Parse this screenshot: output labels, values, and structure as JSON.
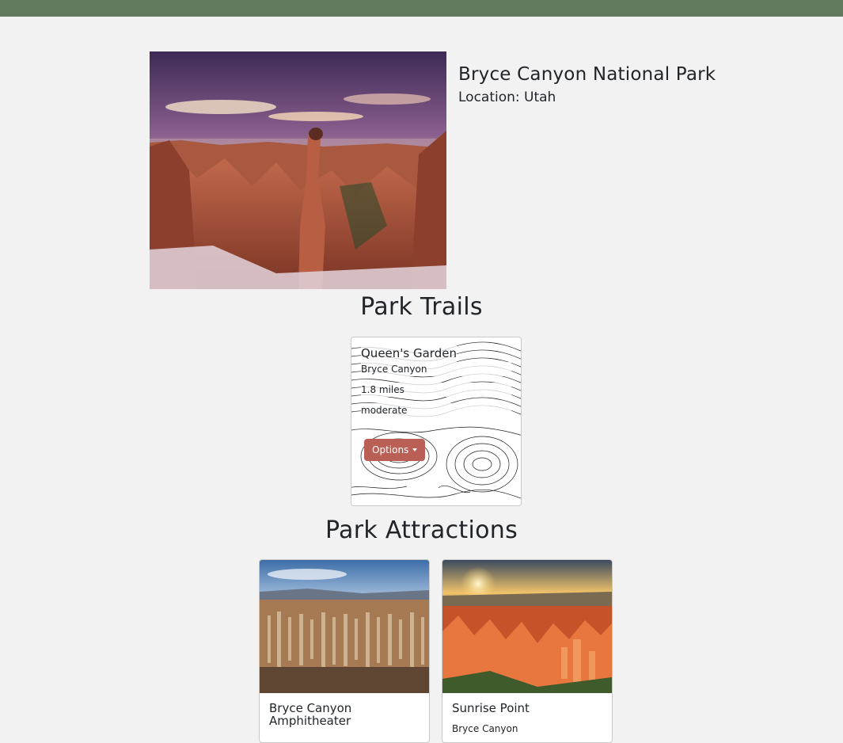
{
  "park": {
    "name": "Bryce Canyon National Park",
    "location": "Location: Utah"
  },
  "sections": {
    "trails_title": "Park Trails",
    "attractions_title": "Park Attractions"
  },
  "trails": [
    {
      "name": "Queen's Garden",
      "park": "Bryce Canyon",
      "length": "1.8 miles",
      "difficulty": "moderate",
      "options_label": "Options"
    }
  ],
  "attractions": [
    {
      "name": "Bryce Canyon Amphitheater"
    },
    {
      "name": "Sunrise Point",
      "sub": "Bryce Canyon"
    }
  ],
  "colors": {
    "topbar": "#647a5e",
    "page_background": "#f2f2f2",
    "options_button": "#b95f55"
  }
}
